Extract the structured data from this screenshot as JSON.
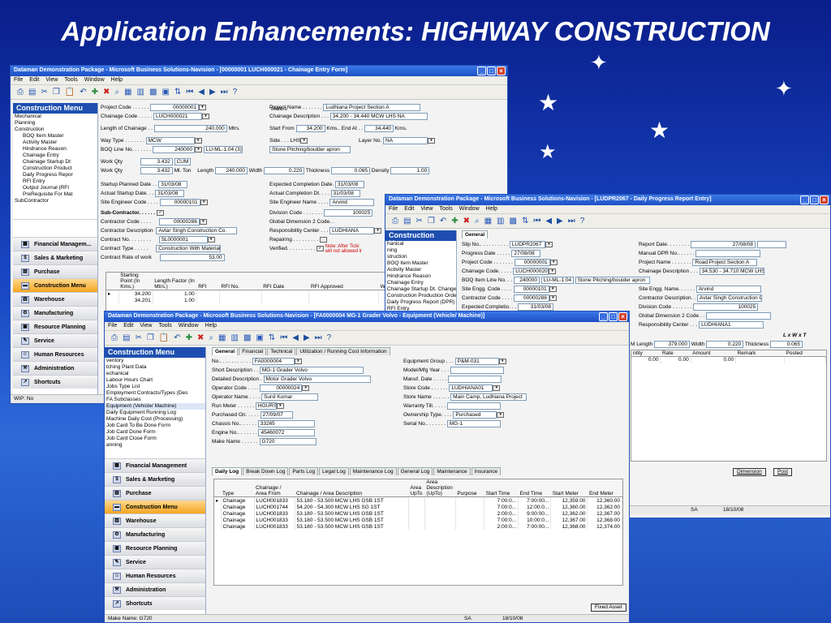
{
  "slide_title": "Application Enhancements: HIGHWAY CONSTRUCTION",
  "menu": [
    "File",
    "Edit",
    "View",
    "Tools",
    "Window",
    "Help"
  ],
  "sidebar_buttons": [
    "Financial Managem...",
    "Sales & Marketing",
    "Purchase",
    "Construction Menu",
    "Warehouse",
    "Manufacturing",
    "Resource Planning",
    "Service",
    "Human Resources",
    "Administration",
    "Shortcuts"
  ],
  "w1": {
    "title": "Dataman Demonstration Package - Microsoft Business Solutions-Navision - [00000001 LUCH000021 - Chainage Entry Form]",
    "nav_title": "Construction Menu",
    "tree": [
      "Mechanical",
      "Planning",
      "Construction",
      "BOQ Item Master",
      "Activity Master",
      "Hindrance Reason",
      "Chainage Entry",
      "Chainage Startup Dt",
      "Construction Product",
      "Daily Progress Repor",
      "RFI Entry",
      "Output Journal (RFI",
      "PreRequisite For Mat",
      "SubContractor"
    ],
    "form": {
      "project_code_l": "Project Code . . . . . .",
      "project_code": "00000001",
      "chainage_code_l": "Chainage Code . . . . .",
      "chainage_code": "LUCH000021",
      "project_name_l": "Project Name . . . . . . .",
      "project_name": "Ludhiana Project Section A",
      "chainage_desc_l": "Chainage Description . . .",
      "chainage_desc": "34.200 - 34.440 MCW LHS NA",
      "length_l": "Length of Chainage . .",
      "length": "240.000",
      "length_u": "Mtrs.",
      "start_from_l": "Start From",
      "start_from": "34.200",
      "kms": "Kms..",
      "end_at_l": "End At . .",
      "end_at": "34.440",
      "kms2": "Kms.",
      "way_type_l": "Way Type . . . . . . .",
      "way_type": "MCW",
      "side_l": "Side . . . LHS",
      "side": "LHS",
      "layer_no_l": "Layer No.",
      "layer_no": "NA",
      "boq_l": "BOQ Line No. . . . . . .",
      "boq_no": "240000",
      "boq_code": "LU-ML-1.04 (3)",
      "boq_desc": "Stone Pitching/boulder apron",
      "work_qty_l": "Work Qty",
      "work_qty": "3.432",
      "work_qty_u": "CUM",
      "work_qty2": "3.432",
      "work_qty2_u": "Ml. Ton",
      "len_l": "Length",
      "len": "240.000",
      "width_l": "Width",
      "width": "0.220",
      "thick_l": "Thickness",
      "thick": "0.065",
      "density_l": "Density",
      "density": "1.00",
      "meters": "Meters",
      "sp_date_l": "Startup Planned Date . .",
      "sp_date": "31/03/08",
      "as_date_l": "Actual Startup Date. . .",
      "as_date": "31/03/08",
      "se_code_l": "Site Engineer Code . . . .",
      "se_code": "00000101",
      "sub_l": "Sub-Contractor. . . . . .",
      "ecd_l": "Expected Completion Date.",
      "ecd": "31/03/08",
      "acd_l": "Actual Completion Dt. . . .",
      "acd": "31/03/08",
      "sen_l": "Site Engineer Name . . . .",
      "sen": "Arvind",
      "cc_l": "Contractor Code . . . .",
      "cc": "00000286",
      "cd_l": "Contractor Description",
      "cd": "Avtar Singh Construction Co.",
      "cno_l": "Contract No. . . . . . . .",
      "cno": "SL0000001",
      "ct_l": "Contract Type . . . . .",
      "ct": "Construction With Material",
      "cr_l": "Contract Rate of work",
      "cr": "53.00",
      "div_l": "Division Code . . . . . . .",
      "div": "100025",
      "gdim_l": "Global Dimension 2 Code. .",
      "rc_l": "Responsibility Center . . .",
      "rc": "LUDHIANA",
      "rep_l": "Repairing . . . . . . . . .",
      "ver_l": "Verified. . . . . . . . . .",
      "note": "Note: After Ticki will not allowed ir"
    },
    "grid_headers": [
      "Starting Point (In Kms.)",
      "Length Factor (In Mtrs.)",
      "RFI",
      "RFI No.",
      "RFI Date",
      "RFI Approved",
      "WIP"
    ],
    "grid_rows": [
      [
        "34.200",
        "1.00"
      ],
      [
        "34.201",
        "1.00"
      ]
    ],
    "status": "WIP: No"
  },
  "w2": {
    "title": "Dataman Demonstration Package - Microsoft Business Solutions-Navision - [LUDPR2067 - Daily Progress Report Entry]",
    "nav_title": "Construction Menu",
    "tree": [
      "hanical",
      "ning",
      "struction",
      "BOQ Item Master",
      "Activity Master",
      "Hindrance Reason",
      "Chainage Entry",
      "Chainage Startup Dt. Change F",
      "Construction Production Order",
      "Daily Progress Report (DPR)",
      "RFI Entry"
    ],
    "tab": "General",
    "left": [
      {
        "l": "Slip No.. . . . . . . . . .",
        "v": "LUDPR2067"
      },
      {
        "l": "Progress Date . . . . .",
        "v": "27/08/08"
      },
      {
        "l": "Project Code . . . . . . .",
        "v": "00000001"
      },
      {
        "l": "Chainage Code. . . . .",
        "v": "LUCH000020"
      },
      {
        "l": "BOQ Item Line No. . .",
        "v": "240000",
        "v2": "LU-ML-1.04 (3)",
        "v3": "Stone Pitching/boulder apron"
      },
      {
        "l": "Site Engg. Code . . . .",
        "v": "00000101"
      },
      {
        "l": "Contractor Code . . . .",
        "v": "00000286"
      },
      {
        "l": "Expected Completio. . .",
        "v": "31/03/08"
      }
    ],
    "right": [
      {
        "l": "Report Date. . . . . . . .",
        "v": "27/08/08"
      },
      {
        "l": "Manual DPR No.. . . . . .",
        "v": ""
      },
      {
        "l": "Project Name . . . . . . .",
        "v": "Road Project Section A"
      },
      {
        "l": "Chainage Description . . .",
        "v": "34.530 - 34.710 MCW LHS NA"
      },
      {
        "l": "Site Engg. Name. . . . . .",
        "v": "Arvind"
      },
      {
        "l": "Contractor Description. .",
        "v": "Avtar Singh Construction Co."
      },
      {
        "l": "Division Code . . . . . . .",
        "v": "100025"
      },
      {
        "l": "Global Dimension 2 Code . .",
        "v": ""
      },
      {
        "l": "Responsibility Center . . .",
        "v": "LUDHIANA1"
      }
    ],
    "lxwxt": "L x W x T",
    "m_l": "M",
    "length_l": "Length",
    "length": "379.000",
    "width_l": "Width",
    "width": "0.220",
    "thick_l": "Thickness",
    "thick": "0.065",
    "grid_headers": [
      "ntity",
      "Rate",
      "Amount",
      "Remark",
      "Posted"
    ],
    "grid_row": [
      "0.00",
      "0.00",
      "0.00"
    ],
    "dim_btn": "Dimension",
    "post_btn": "Post",
    "status_sa": "SA",
    "status_date": "18/10/08"
  },
  "w3": {
    "title": "Dataman Demonstration Package - Microsoft Business Solutions-Navision - [FA0000004 MG-1 Grader Volvo - Equipment (Vehicle/ Machine)]",
    "nav_title": "Construction Menu",
    "tree": [
      "ventory",
      "tching Plant Data",
      "echanical",
      "Labour Hours Chart",
      "Jobs Type List",
      "Employment Contracts/Types (Des",
      "FA Subclasses",
      "Equipment (Vehicle/ Machine)",
      "Daily Equipment Running Log",
      "Machine Daily Cost (Processing)",
      "Job Card To Be Done Form",
      "Job Card Done Form",
      "Job Card Close Form",
      "anning"
    ],
    "tabs": [
      "General",
      "Financial",
      "Technical",
      "Utilization / Running Cost Information"
    ],
    "left": [
      {
        "l": "No.. . . . . . . . . . .",
        "v": "FA0000004"
      },
      {
        "l": "Short Description . .",
        "v": "MG-1 Grader Volvo"
      },
      {
        "l": "Detailed Description .",
        "v": "Motor Grader Volvo"
      },
      {
        "l": "Operator Code . . . .",
        "v": "00000024"
      },
      {
        "l": "Operator Name . . . .",
        "v": "Sunil Kumar"
      },
      {
        "l": "Run Meter . . . . . .",
        "v": "HOURS"
      },
      {
        "l": "Purchased On. . . . .",
        "v": "27/09/07"
      },
      {
        "l": "Chassis No.. . . . . .",
        "v": "33265"
      },
      {
        "l": "Engine No.. . . . . . .",
        "v": "45460072"
      },
      {
        "l": "Make Name . . . . . .",
        "v": "G720"
      }
    ],
    "right": [
      {
        "l": "Equipment Group . . .",
        "v": "P&M-031"
      },
      {
        "l": "Model/Mfg Year . . .",
        "v": ""
      },
      {
        "l": "Manuf. Date . . . . .",
        "v": ""
      },
      {
        "l": "Store Code . . . . . .",
        "v": "LUDHIANA01"
      },
      {
        "l": "Store Name . . . . . .",
        "v": "Main Camp, Ludhiana Project"
      },
      {
        "l": "Warranty Till. . . . .",
        "v": ""
      },
      {
        "l": "Ownership Type. . . .",
        "v": "Purchased"
      },
      {
        "l": "Serial No.. . . . . . .",
        "v": "MG-1"
      }
    ],
    "subtabs": [
      "Daily Log",
      "Break Down Log",
      "Parts Log",
      "Legal Log",
      "Maintenance Log",
      "General Log",
      "Maintenance",
      "Insurance"
    ],
    "grid_headers": [
      "Type",
      "Chainage / Area From",
      "Chainage / Area Description",
      "Area UpTo",
      "Area Description (UpTo)",
      "Purpose",
      "Start Time",
      "End Time",
      "Start Meter",
      "End Meter"
    ],
    "grid_rows": [
      [
        "Chainage",
        "LUCH001833",
        "53.180 - 53.500 MCW LHS GSB 1ST",
        "",
        "",
        "",
        "7:00:0...",
        "7:00:00...",
        "12,359.00",
        "12,360.00"
      ],
      [
        "Chainage",
        "LUCH001744",
        "54.200 - 54.300 MCW LHS SG 1ST",
        "",
        "",
        "",
        "7:00:0...",
        "12:00:0...",
        "12,360.00",
        "12,362.00"
      ],
      [
        "Chainage",
        "LUCH001833",
        "53.180 - 53.500 MCW LHS GSB 1ST",
        "",
        "",
        "",
        "2:00:0...",
        "9:00:00...",
        "12,362.00",
        "12,367.00"
      ],
      [
        "Chainage",
        "LUCH001833",
        "53.180 - 53.500 MCW LHS GSB 1ST",
        "",
        "",
        "",
        "7:00:0...",
        "10:00:0...",
        "12,367.00",
        "12,368.00"
      ],
      [
        "Chainage",
        "LUCH001833",
        "53.180 - 53.500 MCW LHS GSB 1ST",
        "",
        "",
        "",
        "2:00:0...",
        "7:00:00...",
        "12,368.00",
        "12,374.00"
      ]
    ],
    "fixed_asset_btn": "Fixed Asset",
    "status_make": "Make Name: G720",
    "status_sa": "SA",
    "status_date": "18/10/08"
  }
}
